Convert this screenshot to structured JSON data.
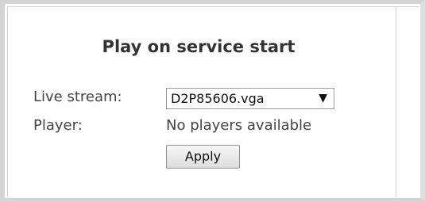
{
  "panel": {
    "title": "Play on service start",
    "live_stream": {
      "label": "Live stream:",
      "selected": "D2P85606.vga",
      "arrow_icon": "triangle-down-icon"
    },
    "player": {
      "label": "Player:",
      "value": "No players available"
    },
    "apply_label": "Apply"
  },
  "colors": {
    "frame_border": "#d4d4d4",
    "text": "#444444",
    "title": "#333333"
  }
}
